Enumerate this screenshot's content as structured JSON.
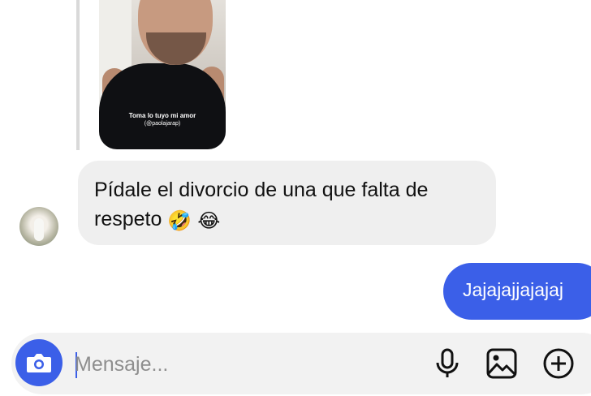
{
  "story": {
    "caption_line1": "Toma lo tuyo mi amor",
    "caption_line2": "(@paolajarap)"
  },
  "messages": [
    {
      "direction": "incoming",
      "text_line1": "Pídale el divorcio de una que falta de",
      "text_line2": "respeto",
      "emojis": [
        "🤣",
        "😂"
      ]
    },
    {
      "direction": "outgoing",
      "text": "Jajajajjajajaj"
    }
  ],
  "composer": {
    "placeholder": "Mensaje...",
    "icons": [
      "camera-icon",
      "microphone-icon",
      "gallery-icon",
      "plus-icon"
    ]
  },
  "colors": {
    "accent": "#3b5fe8",
    "incoming_bubble": "#efefef",
    "composer_bg": "#f2f2f2"
  }
}
